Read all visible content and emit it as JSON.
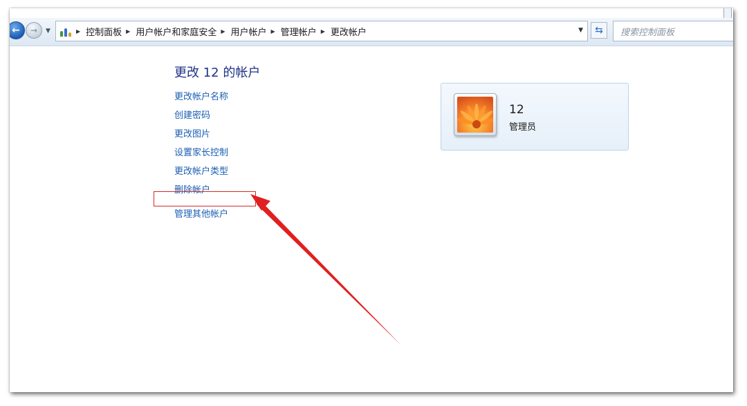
{
  "nav": {
    "breadcrumbs": [
      "控制面板",
      "用户帐户和家庭安全",
      "用户帐户",
      "管理帐户",
      "更改帐户"
    ],
    "search_placeholder": "搜索控制面板"
  },
  "main": {
    "title": "更改 12 的帐户",
    "links": [
      "更改帐户名称",
      "创建密码",
      "更改图片",
      "设置家长控制",
      "更改帐户类型",
      "删除帐户",
      "管理其他帐户"
    ]
  },
  "account": {
    "name": "12",
    "role": "管理员"
  },
  "colors": {
    "link": "#1a5fb4",
    "title": "#1e3287",
    "annotation": "#e02020"
  },
  "icons": [
    "back-arrow-icon",
    "forward-arrow-icon",
    "recent-pages-dropdown-icon",
    "control-panel-icon",
    "breadcrumb-chevron-icon",
    "address-dropdown-icon",
    "refresh-icon",
    "flower-avatar-icon"
  ]
}
